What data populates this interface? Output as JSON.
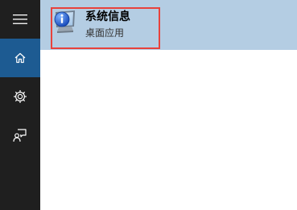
{
  "sidebar": {
    "items": [
      {
        "icon": "hamburger-menu-icon",
        "active": false
      },
      {
        "icon": "home-icon",
        "active": true
      },
      {
        "icon": "settings-gear-icon",
        "active": false
      },
      {
        "icon": "feedback-icon",
        "active": false
      }
    ]
  },
  "results": [
    {
      "title": "系统信息",
      "subtitle": "桌面应用",
      "icon": "system-info-icon",
      "selected": true
    }
  ],
  "colors": {
    "sidebar_bg": "#1f1f1f",
    "active_item_bg": "#1d5b92",
    "selected_result_bg": "#b4cde3",
    "highlight_border": "#e8423c"
  }
}
